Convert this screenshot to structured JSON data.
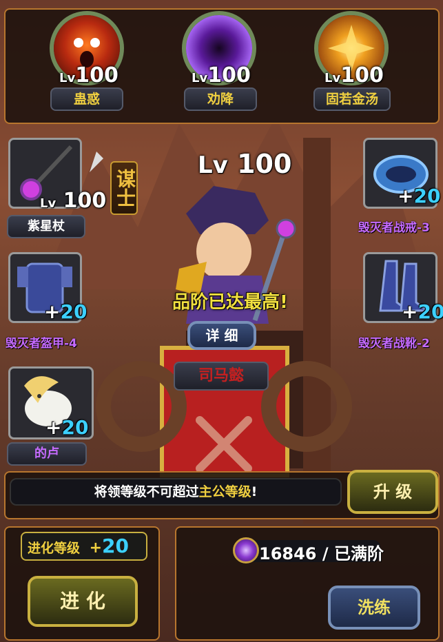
{
  "skills": [
    {
      "level_prefix": "Lv",
      "level": "100",
      "name": "蛊惑",
      "icon": "demon-face-icon"
    },
    {
      "level_prefix": "Lv",
      "level": "100",
      "name": "劝降",
      "icon": "purple-vortex-icon"
    },
    {
      "level_prefix": "Lv",
      "level": "100",
      "name": "固若金汤",
      "icon": "golden-shield-icon"
    }
  ],
  "hero": {
    "class_label": "谋士",
    "level_prefix": "Lv",
    "level": "100",
    "max_rank_text": "品阶已达最高!",
    "detail_button": "详 细",
    "name": "司马懿"
  },
  "equipment": {
    "weapon": {
      "name": "紫星杖",
      "level_prefix": "Lv",
      "level": "100"
    },
    "armor": {
      "name": "毁灭者盔甲-4",
      "plus": "+",
      "bonus": "20"
    },
    "mount": {
      "name": "的卢",
      "plus": "+",
      "bonus": "20"
    },
    "ring": {
      "name": "毁灭者战戒-3",
      "plus": "+",
      "bonus": "20"
    },
    "boots": {
      "name": "毁灭者战靴-2",
      "plus": "+",
      "bonus": "20"
    }
  },
  "level_bar": {
    "message_prefix": "将领等级不可超过",
    "message_highlight": "主公等级",
    "message_suffix": "!",
    "upgrade_button": "升 级"
  },
  "evolution": {
    "label": "进化等级",
    "plus": "+",
    "value": "20",
    "button": "进 化"
  },
  "refine": {
    "amount": "16846",
    "separator": " / ",
    "status": "已满阶",
    "button": "洗练"
  },
  "colors": {
    "gold_text": "#f0d040",
    "purple_name": "#c66bff",
    "cyan_bonus": "#3cd0ff",
    "panel_border": "#b8762e"
  }
}
